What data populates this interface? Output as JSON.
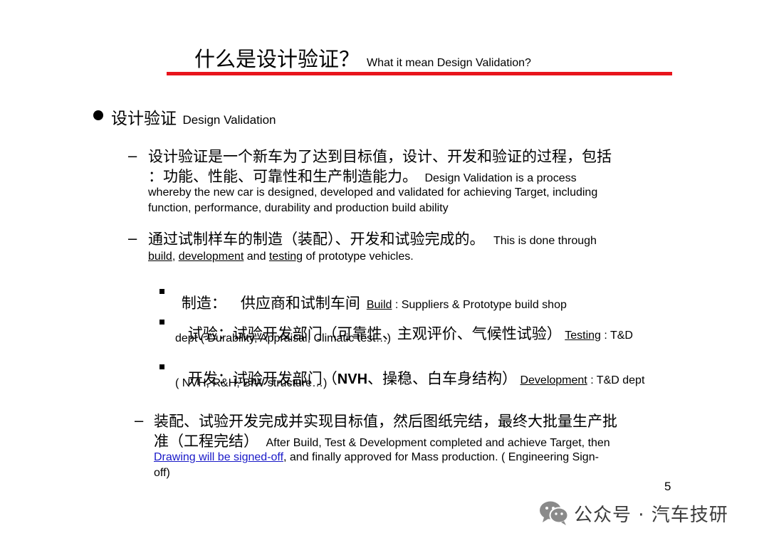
{
  "slide": {
    "title_zh": "什么是设计验证？",
    "title_en": "What it mean Design Validation?",
    "colors": {
      "title_rule": "#e8141c",
      "link": "#1a1ac8"
    },
    "main_bullet": {
      "zh": "设计验证",
      "en": "Design Validation"
    },
    "item1": {
      "zh_line1": "设计验证是一个新车为了达到目标值，设计、开发和验证的过程，包括",
      "zh_line2": "：功能、性能、可靠性和生产制造能力。",
      "en_line2": "Design Validation is a process",
      "en_line3": "whereby the new car is designed, developed and validated for achieving Target, including",
      "en_line4": "function, performance, durability and production build ability"
    },
    "item2": {
      "zh_line1": "通过试制样车的制造（装配）、开发和试验完成的。",
      "en_line1": "This is done through",
      "w_build": "build",
      "sep1": ", ",
      "w_development": "development",
      "sep2": " and ",
      "w_testing": "testing",
      "rest": " of prototype vehicles."
    },
    "sub_items": [
      {
        "zh": "制造：   供应商和试制车间",
        "en_u": "Build",
        "en_rest": " : Suppliers & Prototype build shop"
      },
      {
        "zh": "试验：试验开发部门（可靠性、主观评价、气候性试验）",
        "en_u": "Testing",
        "en_rest": " : T&D",
        "line2": "dept ( Durability, Appraisal, Climatic test…)"
      },
      {
        "zh_a": "开发：试验开发部门（",
        "bold": "NVH",
        "zh_b": "、操稳、白车身结构）",
        "en_u": "Development",
        "en_rest": " : T&D dept",
        "line2": "( NVH, R&H, BIW structure…)"
      }
    ],
    "item3": {
      "zh_line1": "装配、试验开发完成并实现目标值，然后图纸完结，最终大批量生产批",
      "zh_line2": "准（工程完结）",
      "en_line2": "After Build, Test & Development completed and achieve Target, then",
      "link_text": "Drawing will be signed-off",
      "en_line3_rest": ", and finally approved for Mass production. ( Engineering Sign-",
      "en_line4": "off)"
    },
    "page_number": "5",
    "watermark": {
      "icon": "wechat-icon",
      "text": "公众号 · 汽车技研"
    }
  }
}
